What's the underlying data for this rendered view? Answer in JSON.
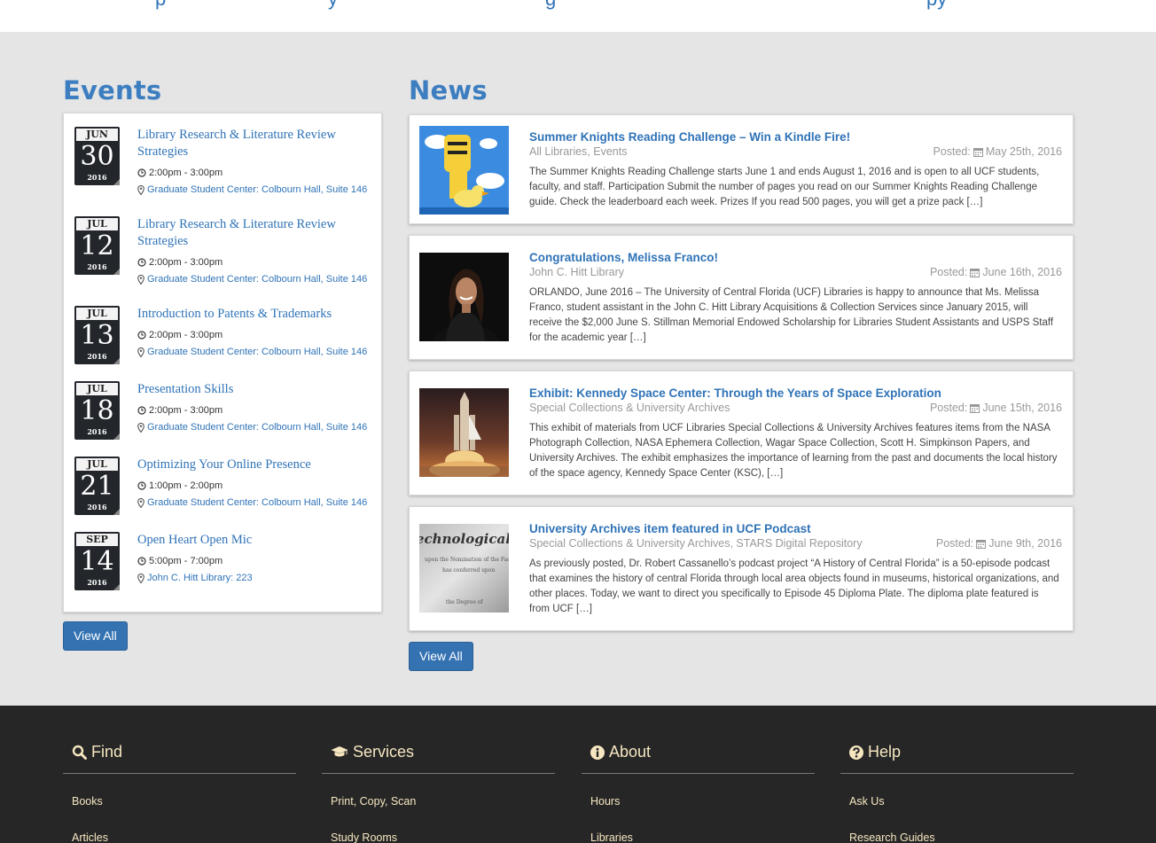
{
  "events": {
    "heading": "Events",
    "view_all": "View All",
    "items": [
      {
        "month": "JUN",
        "day": "30",
        "year": "2016",
        "title": "Library Research & Literature Review Strategies",
        "time": "2:00pm - 3:00pm",
        "location": "Graduate Student Center: Colbourn Hall, Suite 146"
      },
      {
        "month": "JUL",
        "day": "12",
        "year": "2016",
        "title": "Library Research & Literature Review Strategies",
        "time": "2:00pm - 3:00pm",
        "location": "Graduate Student Center: Colbourn Hall, Suite 146"
      },
      {
        "month": "JUL",
        "day": "13",
        "year": "2016",
        "title": "Introduction to Patents & Trademarks",
        "time": "2:00pm - 3:00pm",
        "location": "Graduate Student Center: Colbourn Hall, Suite 146"
      },
      {
        "month": "JUL",
        "day": "18",
        "year": "2016",
        "title": "Presentation Skills",
        "time": "2:00pm - 3:00pm",
        "location": "Graduate Student Center: Colbourn Hall, Suite 146"
      },
      {
        "month": "JUL",
        "day": "21",
        "year": "2016",
        "title": "Optimizing Your Online Presence",
        "time": "1:00pm - 2:00pm",
        "location": "Graduate Student Center: Colbourn Hall, Suite 146"
      },
      {
        "month": "SEP",
        "day": "14",
        "year": "2016",
        "title": "Open Heart Open Mic",
        "time": "5:00pm - 7:00pm",
        "location": "John C. Hitt Library: 223"
      }
    ]
  },
  "news": {
    "heading": "News",
    "view_all": "View All",
    "items": [
      {
        "title": "Summer Knights Reading Challenge – Win a Kindle Fire!",
        "category": "All Libraries, Events",
        "posted_label": "Posted:",
        "date": "May 25th, 2016",
        "body": "The Summer Knights Reading Challenge starts June 1 and ends August 1, 2016 and is open to all UCF students, faculty, and staff. Participation Submit the number of pages you read on our Summer Knights Reading Challenge guide. Check the leaderboard each week. Prizes If you read 500 pages, you will get a prize pack […]"
      },
      {
        "title": "Congratulations, Melissa Franco!",
        "category": "John C. Hitt Library",
        "posted_label": "Posted:",
        "date": "June 16th, 2016",
        "body": "ORLANDO, June 2016 – The University of Central Florida (UCF) Libraries is happy to announce that Ms. Melissa Franco, student assistant in the John C. Hitt Library Acquisitions & Collection Services since January 2015, will receive the $2,000 June S. Stillman Memorial Endowed Scholarship for Libraries Student Assistants and USPS Staff for the academic year […]"
      },
      {
        "title": "Exhibit: Kennedy Space Center: Through the Years of Space Exploration",
        "category": "Special Collections & University Archives",
        "posted_label": "Posted:",
        "date": "June 15th, 2016",
        "body": "This exhibit of materials from UCF Libraries Special Collections & University Archives features items from the NASA Photograph Collection, NASA Ephemera Collection, Wagar Space Collection, Scott H. Simpkinson Papers, and University Archives. The exhibit emphasizes the importance of learning from the past and documents the local history of the space agency, Kennedy Space Center (KSC), […]"
      },
      {
        "title": "University Archives item featured in UCF Podcast",
        "category": "Special Collections & University Archives, STARS Digital Repository",
        "posted_label": "Posted:",
        "date": "June 9th, 2016",
        "body": "As previously posted, Dr. Robert Cassanello’s podcast project “A History of Central Florida” is a 50-episode podcast that examines the history of central Florida through local area objects found in museums, historical organizations, and other places. Today, we want to direct you specifically to Episode 45 Diploma Plate. The diploma plate featured is from UCF […]"
      }
    ]
  },
  "footer": {
    "columns": [
      {
        "heading": "Find",
        "icon": "search-icon",
        "links": [
          "Books",
          "Articles"
        ]
      },
      {
        "heading": "Services",
        "icon": "graduation-cap-icon",
        "links": [
          "Print, Copy, Scan",
          "Study Rooms"
        ]
      },
      {
        "heading": "About",
        "icon": "info-circle-icon",
        "links": [
          "Hours",
          "Libraries"
        ]
      },
      {
        "heading": "Help",
        "icon": "question-circle-icon",
        "links": [
          "Ask Us",
          "Research Guides"
        ]
      }
    ]
  },
  "colors": {
    "link": "#2f73b7",
    "heading": "#3d7ec0",
    "footer_text": "#f6e7c1",
    "button": "#3472b2"
  }
}
